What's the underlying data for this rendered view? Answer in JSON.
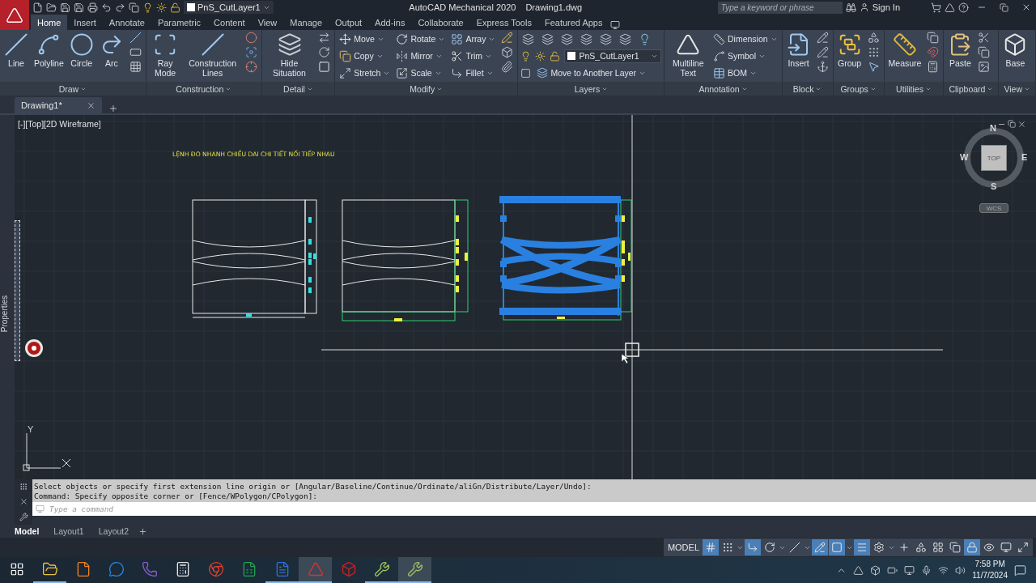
{
  "title_bar": {
    "layer": "PnS_CutLayer1",
    "app_title": "AutoCAD Mechanical 2020",
    "file_name": "Drawing1.dwg",
    "search": {
      "placeholder": "Type a keyword or phrase"
    },
    "sign_in": "Sign In"
  },
  "ribbon_tabs": [
    {
      "label": "Home",
      "selected": true
    },
    {
      "label": "Insert",
      "selected": false
    },
    {
      "label": "Annotate",
      "selected": false
    },
    {
      "label": "Parametric",
      "selected": false
    },
    {
      "label": "Content",
      "selected": false
    },
    {
      "label": "View",
      "selected": false
    },
    {
      "label": "Manage",
      "selected": false
    },
    {
      "label": "Output",
      "selected": false
    },
    {
      "label": "Add-ins",
      "selected": false
    },
    {
      "label": "Collaborate",
      "selected": false
    },
    {
      "label": "Express Tools",
      "selected": false
    },
    {
      "label": "Featured Apps",
      "selected": false
    }
  ],
  "ribbon_panels": [
    {
      "title": "Draw",
      "columns": [
        {
          "kind": "large",
          "label": "Line"
        },
        {
          "kind": "large",
          "label": "Polyline"
        },
        {
          "kind": "large",
          "label": "Circle"
        },
        {
          "kind": "large",
          "label": "Arc"
        },
        {
          "kind": "stack",
          "items": [
            {
              "kind": "icon"
            },
            {
              "kind": "icon"
            },
            {
              "kind": "icon"
            }
          ]
        }
      ]
    },
    {
      "title": "Construction",
      "columns": [
        {
          "kind": "large",
          "label": "Ray Mode"
        },
        {
          "kind": "large",
          "label": "Construction Lines"
        },
        {
          "kind": "stack",
          "items": [
            {
              "kind": "icon"
            },
            {
              "kind": "icon"
            },
            {
              "kind": "icon"
            }
          ]
        }
      ]
    },
    {
      "title": "Detail",
      "columns": [
        {
          "kind": "large",
          "label": "Hide Situation"
        },
        {
          "kind": "stack",
          "items": [
            {
              "kind": "icon"
            },
            {
              "kind": "icon"
            },
            {
              "kind": "icon"
            }
          ]
        }
      ]
    },
    {
      "title": "Modify",
      "columns": [
        {
          "kind": "stack",
          "items": [
            {
              "kind": "labeled",
              "label": "Move"
            },
            {
              "kind": "labeled",
              "label": "Copy"
            },
            {
              "kind": "labeled",
              "label": "Stretch"
            }
          ]
        },
        {
          "kind": "stack",
          "items": [
            {
              "kind": "labeled",
              "label": "Rotate"
            },
            {
              "kind": "labeled",
              "label": "Mirror"
            },
            {
              "kind": "labeled",
              "label": "Scale"
            }
          ]
        },
        {
          "kind": "stack",
          "items": [
            {
              "kind": "labeled",
              "label": "Array"
            },
            {
              "kind": "labeled",
              "label": "Trim"
            },
            {
              "kind": "labeled",
              "label": "Fillet"
            }
          ]
        },
        {
          "kind": "stack",
          "items": [
            {
              "kind": "icon"
            },
            {
              "kind": "icon"
            },
            {
              "kind": "icon"
            }
          ]
        }
      ]
    },
    {
      "title": "Layers",
      "columns": [
        {
          "kind": "layers",
          "layer": "PnS_CutLayer1",
          "action": "Move to Another Layer"
        }
      ]
    },
    {
      "title": "Annotation",
      "columns": [
        {
          "kind": "large",
          "label": "Multiline Text"
        },
        {
          "kind": "stack",
          "items": [
            {
              "kind": "labeled",
              "label": "Dimension"
            },
            {
              "kind": "labeled",
              "label": "Symbol"
            },
            {
              "kind": "labeled",
              "label": "BOM"
            }
          ]
        }
      ]
    },
    {
      "title": "Block",
      "columns": [
        {
          "kind": "large",
          "label": "Insert"
        },
        {
          "kind": "stack",
          "items": [
            {
              "kind": "icon"
            },
            {
              "kind": "icon"
            },
            {
              "kind": "icon"
            }
          ]
        }
      ]
    },
    {
      "title": "Groups",
      "columns": [
        {
          "kind": "large",
          "label": "Group"
        },
        {
          "kind": "stack",
          "items": [
            {
              "kind": "icon"
            },
            {
              "kind": "icon"
            },
            {
              "kind": "icon"
            }
          ]
        }
      ]
    },
    {
      "title": "Utilities",
      "columns": [
        {
          "kind": "large",
          "label": "Measure"
        },
        {
          "kind": "stack",
          "items": [
            {
              "kind": "icon"
            },
            {
              "kind": "icon"
            },
            {
              "kind": "icon"
            }
          ]
        }
      ]
    },
    {
      "title": "Clipboard",
      "columns": [
        {
          "kind": "large",
          "label": "Paste"
        },
        {
          "kind": "stack",
          "items": [
            {
              "kind": "icon"
            },
            {
              "kind": "icon"
            },
            {
              "kind": "icon"
            }
          ]
        }
      ]
    },
    {
      "title": "View",
      "columns": [
        {
          "kind": "large",
          "label": "Base"
        }
      ]
    }
  ],
  "file_tabs": [
    {
      "label": "Drawing1*",
      "selected": true
    }
  ],
  "viewport": {
    "label": "[-][Top][2D Wireframe]",
    "drawing_title": "LỆNH ĐO NHANH CHIỀU DAI CHI TIẾT NỐI TIẾP NHAU",
    "properties_label": "Properties",
    "viewcube": {
      "face": "TOP",
      "north": "N",
      "south": "S",
      "east": "E",
      "west": "W",
      "ucs": "WCS"
    },
    "ucs_axis": {
      "y": "Y"
    }
  },
  "command_line": {
    "history": [
      "Select objects or specify first extension line origin or [Angular/Baseline/Continue/Ordinate/aliGn/Distribute/Layer/Undo]:",
      "Command: Specify opposite corner or [Fence/WPolygon/CPolygon]:"
    ],
    "placeholder": "Type a command"
  },
  "layout_tabs": [
    {
      "label": "Model",
      "selected": true
    },
    {
      "label": "Layout1",
      "selected": false
    },
    {
      "label": "Layout2",
      "selected": false
    }
  ],
  "status_bar": {
    "space": "MODEL",
    "toggles": [
      {
        "on": true
      },
      {
        "on": false
      },
      {
        "on": true
      },
      {
        "on": false
      },
      {
        "on": false
      },
      {
        "on": true
      },
      {
        "on": true
      },
      {
        "on": true
      },
      {
        "on": false
      },
      {
        "on": false
      },
      {
        "on": false
      },
      {
        "on": false
      },
      {
        "on": false
      },
      {
        "on": true
      },
      {
        "on": false
      },
      {
        "on": false
      },
      {
        "on": false
      }
    ]
  },
  "taskbar": {
    "apps": [
      {
        "kind": "explorer",
        "running": true,
        "selected": false
      },
      {
        "kind": "pdf",
        "running": false,
        "selected": false
      },
      {
        "kind": "chat",
        "running": false,
        "selected": false
      },
      {
        "kind": "phone",
        "running": false,
        "selected": false
      },
      {
        "kind": "calculator",
        "running": false,
        "selected": false
      },
      {
        "kind": "browser",
        "running": false,
        "selected": false
      },
      {
        "kind": "sheet",
        "running": false,
        "selected": false
      },
      {
        "kind": "doc",
        "running": true,
        "selected": false
      },
      {
        "kind": "cad",
        "running": true,
        "selected": true
      },
      {
        "kind": "solid",
        "running": false,
        "selected": false
      },
      {
        "kind": "tool",
        "running": true,
        "selected": false
      },
      {
        "kind": "tool",
        "running": true,
        "selected": true
      }
    ],
    "time": "7:58 PM",
    "date": "11/7/2024"
  }
}
